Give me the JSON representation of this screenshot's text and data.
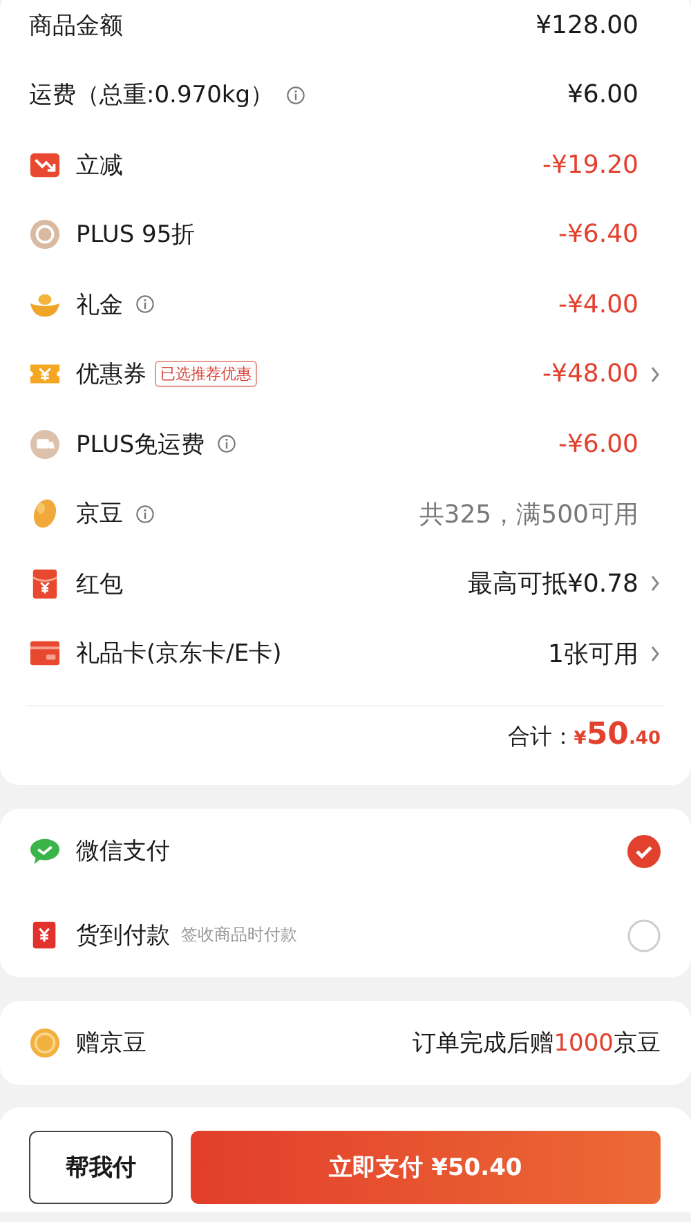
{
  "price_rows": [
    {
      "kind": "amount",
      "label": "商品金额",
      "info": false,
      "value": "¥128.00",
      "chevron": false
    },
    {
      "kind": "amount",
      "label": "运费（总重:0.970kg）",
      "info": true,
      "value": "¥6.00",
      "chevron": false
    },
    {
      "kind": "discount",
      "label": "立减",
      "info": false,
      "value": "-¥19.20",
      "chevron": false
    },
    {
      "kind": "discount",
      "label": "PLUS 95折",
      "info": false,
      "value": "-¥6.40",
      "chevron": false
    },
    {
      "kind": "discount",
      "label": "礼金",
      "info": true,
      "value": "-¥4.00",
      "chevron": false
    },
    {
      "kind": "discount",
      "label": "优惠券",
      "info": false,
      "tag": "已选推荐优惠",
      "value": "-¥48.00",
      "chevron": true
    },
    {
      "kind": "discount",
      "label": "PLUS免运费",
      "info": true,
      "value": "-¥6.00",
      "chevron": false
    },
    {
      "kind": "hint",
      "label": "京豆",
      "info": true,
      "value": "共325，满500可用",
      "chevron": false
    },
    {
      "kind": "amount",
      "label": "红包",
      "info": false,
      "value": "最高可抵¥0.78",
      "chevron": true
    },
    {
      "kind": "amount",
      "label": "礼品卡(京东卡/E卡)",
      "info": false,
      "value": "1张可用",
      "chevron": true
    }
  ],
  "total": {
    "label": "合计：",
    "currency": "¥",
    "integer": "50",
    "decimals": ".40"
  },
  "payment_methods": [
    {
      "label": "微信支付",
      "selected": true
    },
    {
      "label": "货到付款",
      "note": "签收商品时付款",
      "selected": false
    }
  ],
  "gift_beans": {
    "label": "赠京豆",
    "value_before": "订单完成后赠",
    "value_highlight": "1000",
    "value_after": "京豆"
  },
  "footer": {
    "help_pay": "帮我付",
    "pay_now": "立即支付 ¥50.40"
  }
}
